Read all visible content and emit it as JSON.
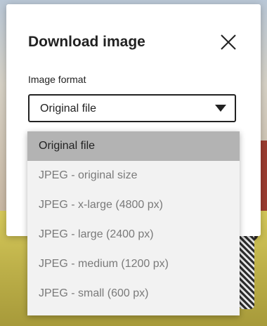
{
  "dialog": {
    "title": "Download image",
    "close_icon": "close-icon"
  },
  "format": {
    "label": "Image format",
    "selected": "Original file",
    "arrow_icon": "caret-down-icon"
  },
  "menu": {
    "options": [
      {
        "label": "Original file",
        "selected": true
      },
      {
        "label": "JPEG - original size",
        "selected": false
      },
      {
        "label": "JPEG - x-large (4800 px)",
        "selected": false
      },
      {
        "label": "JPEG - large (2400 px)",
        "selected": false
      },
      {
        "label": "JPEG - medium (1200 px)",
        "selected": false
      },
      {
        "label": "JPEG - small (600 px)",
        "selected": false
      }
    ]
  },
  "colors": {
    "dialog_bg": "#ffffff",
    "menu_bg": "#f2f2f2",
    "selected_bg": "#b3b3b3",
    "text": "#222222",
    "muted_text": "#7a7a7a"
  }
}
